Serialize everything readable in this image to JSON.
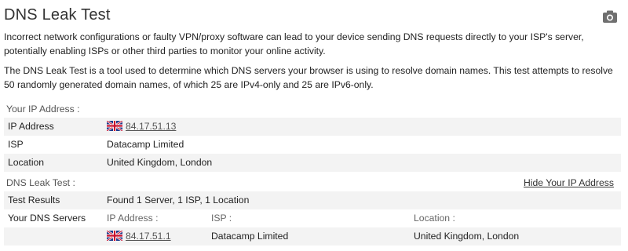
{
  "title": "DNS Leak Test",
  "intro_1": "Incorrect network configurations or faulty VPN/proxy software can lead to your device sending DNS requests directly to your ISP's server, potentially enabling ISPs or other third parties to monitor your online activity.",
  "intro_2": "The DNS Leak Test is a tool used to determine which DNS servers your browser is using to resolve domain names. This test attempts to resolve 50 randomly generated domain names, of which 25 are IPv4-only and 25 are IPv6-only.",
  "your_ip": {
    "section_label": "Your IP Address :",
    "ip_label": "IP Address",
    "ip_value": "84.17.51.13",
    "isp_label": "ISP",
    "isp_value": "Datacamp Limited",
    "location_label": "Location",
    "location_value": "United Kingdom, London"
  },
  "dns_test": {
    "section_label": "DNS Leak Test :",
    "hide_link": "Hide Your IP Address",
    "results_label": "Test Results",
    "results_value": "Found 1 Server, 1 ISP, 1 Location",
    "servers_label": "Your DNS Servers",
    "col_ip": "IP Address :",
    "col_isp": "ISP :",
    "col_location": "Location :",
    "servers": [
      {
        "ip": "84.17.51.1",
        "isp": "Datacamp Limited",
        "location": "United Kingdom, London",
        "flag": "uk-flag-icon"
      }
    ]
  },
  "icons": {
    "camera": "camera-icon",
    "flag": "uk-flag-icon"
  },
  "colors": {
    "row_shade": "#f3f3f3",
    "text": "#222222",
    "muted": "#666666"
  }
}
